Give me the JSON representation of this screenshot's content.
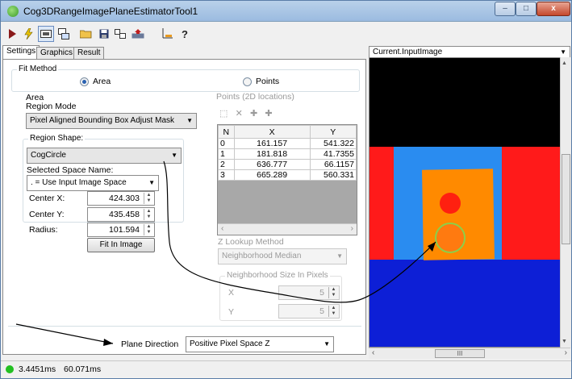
{
  "window": {
    "title": "Cog3DRangeImagePlaneEstimatorTool1",
    "min_label": "–",
    "max_label": "□",
    "close_label": "x"
  },
  "tabs": [
    "Settings",
    "Graphics",
    "Result"
  ],
  "fit_method": {
    "legend": "Fit Method",
    "option_area": "Area",
    "option_points": "Points",
    "selected": "Area"
  },
  "area": {
    "legend": "Area",
    "region_mode_label": "Region Mode",
    "region_mode_value": "Pixel Aligned Bounding Box Adjust Mask",
    "region_shape_legend": "Region Shape:",
    "region_shape_value": "CogCircle",
    "selected_space_label": "Selected Space Name:",
    "selected_space_value": ". = Use Input Image Space",
    "center_x_label": "Center X:",
    "center_x_value": "424.303",
    "center_y_label": "Center Y:",
    "center_y_value": "435.458",
    "radius_label": "Radius:",
    "radius_value": "101.594",
    "fit_button": "Fit In Image"
  },
  "points": {
    "legend": "Points (2D locations)",
    "columns": [
      "N",
      "X",
      "Y"
    ],
    "rows": [
      [
        "0",
        "161.157",
        "541.322"
      ],
      [
        "1",
        "181.818",
        "41.7355"
      ],
      [
        "2",
        "636.777",
        "66.1157"
      ],
      [
        "3",
        "665.289",
        "560.331"
      ]
    ],
    "scroll_left": "‹",
    "scroll_right": "›"
  },
  "z_lookup": {
    "label": "Z Lookup Method",
    "value": "Neighborhood Median"
  },
  "neighborhood": {
    "legend": "Neighborhood Size In Pixels",
    "x_label": "X",
    "x_value": "5",
    "y_label": "Y",
    "y_value": "5"
  },
  "plane_direction": {
    "label": "Plane Direction",
    "value": "Positive Pixel Space Z"
  },
  "image_view": {
    "source": "Current.InputImage",
    "scroll_thumb_label": "III",
    "scroll_left": "‹",
    "scroll_right": "›"
  },
  "status": {
    "time1": "3.4451ms",
    "time2": "60.071ms",
    "indicator_color": "#22c022"
  },
  "colors": {
    "accent": "#2a62b2",
    "image_red": "#ff1a1a",
    "image_blue": "#0d1fd6",
    "image_orange": "#ff8a00"
  }
}
